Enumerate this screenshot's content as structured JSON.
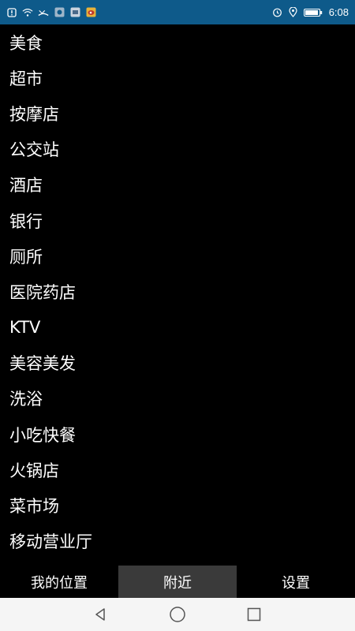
{
  "status_bar": {
    "time": "6:08",
    "icons_left": [
      "alert-icon",
      "wifi-icon",
      "missed-call-icon",
      "app-icon-1",
      "app-icon-2",
      "weibo-icon"
    ],
    "icons_right": [
      "alarm-icon",
      "location-icon",
      "battery-icon"
    ],
    "background_color": "#0e5a8a"
  },
  "categories": [
    {
      "label": "美食"
    },
    {
      "label": "超市"
    },
    {
      "label": "按摩店"
    },
    {
      "label": "公交站"
    },
    {
      "label": "酒店"
    },
    {
      "label": "银行"
    },
    {
      "label": "厕所"
    },
    {
      "label": "医院药店"
    },
    {
      "label": "KTV"
    },
    {
      "label": "美容美发"
    },
    {
      "label": "洗浴"
    },
    {
      "label": "小吃快餐"
    },
    {
      "label": "火锅店"
    },
    {
      "label": "菜市场"
    },
    {
      "label": "移动营业厅"
    }
  ],
  "tabs": [
    {
      "label": "我的位置",
      "active": false
    },
    {
      "label": "附近",
      "active": true
    },
    {
      "label": "设置",
      "active": false
    }
  ],
  "nav": {
    "buttons": [
      "back-icon",
      "home-icon",
      "recents-icon"
    ]
  }
}
